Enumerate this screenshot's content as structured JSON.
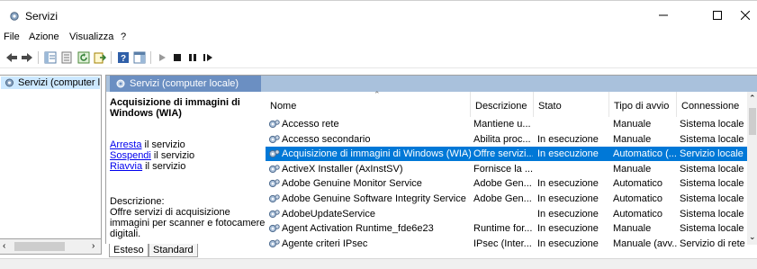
{
  "window": {
    "title": "Servizi"
  },
  "menu": [
    "File",
    "Azione",
    "Visualizza",
    "?"
  ],
  "tree": {
    "selected": "Servizi (computer locale)"
  },
  "header": {
    "title": "Servizi (computer locale)"
  },
  "details": {
    "service_title": "Acquisizione di immagini di Windows (WIA)",
    "actions": [
      {
        "link": "Arresta",
        "rest": " il servizio"
      },
      {
        "link": "Sospendi",
        "rest": " il servizio"
      },
      {
        "link": "Riavvia",
        "rest": " il servizio"
      }
    ],
    "description_label": "Descrizione:",
    "description_text": "Offre servizi di acquisizione immagini per scanner e fotocamere digitali."
  },
  "columns": [
    "Nome",
    "Descrizione",
    "Stato",
    "Tipo di avvio",
    "Connessione"
  ],
  "rows": [
    {
      "name": "Accesso rete",
      "desc": "Mantiene u...",
      "status": "",
      "startup": "Manuale",
      "logon": "Sistema locale"
    },
    {
      "name": "Accesso secondario",
      "desc": "Abilita proc...",
      "status": "In esecuzione",
      "startup": "Manuale",
      "logon": "Sistema locale"
    },
    {
      "name": "Acquisizione di immagini di Windows (WIA)",
      "desc": "Offre servizi...",
      "status": "In esecuzione",
      "startup": "Automatico (...",
      "logon": "Servizio locale",
      "selected": true
    },
    {
      "name": "ActiveX Installer (AxInstSV)",
      "desc": "Fornisce la ...",
      "status": "",
      "startup": "Manuale",
      "logon": "Sistema locale"
    },
    {
      "name": "Adobe Genuine Monitor Service",
      "desc": "Adobe Gen...",
      "status": "In esecuzione",
      "startup": "Automatico",
      "logon": "Sistema locale"
    },
    {
      "name": "Adobe Genuine Software Integrity Service",
      "desc": "Adobe Gen...",
      "status": "In esecuzione",
      "startup": "Automatico",
      "logon": "Sistema locale"
    },
    {
      "name": "AdobeUpdateService",
      "desc": "",
      "status": "In esecuzione",
      "startup": "Automatico",
      "logon": "Sistema locale"
    },
    {
      "name": "Agent Activation Runtime_fde6e23",
      "desc": "Runtime for...",
      "status": "In esecuzione",
      "startup": "Manuale",
      "logon": "Sistema locale"
    },
    {
      "name": "Agente criteri IPsec",
      "desc": "IPsec (Inter...",
      "status": "In esecuzione",
      "startup": "Manuale (avv...",
      "logon": "Servizio di rete"
    }
  ],
  "tabs": [
    "Esteso",
    "Standard"
  ],
  "colors": {
    "selection": "#0078d7",
    "header_band": "#a9c1dc",
    "header_tab": "#6b8fc2",
    "tree_selection": "#cce8ff"
  }
}
